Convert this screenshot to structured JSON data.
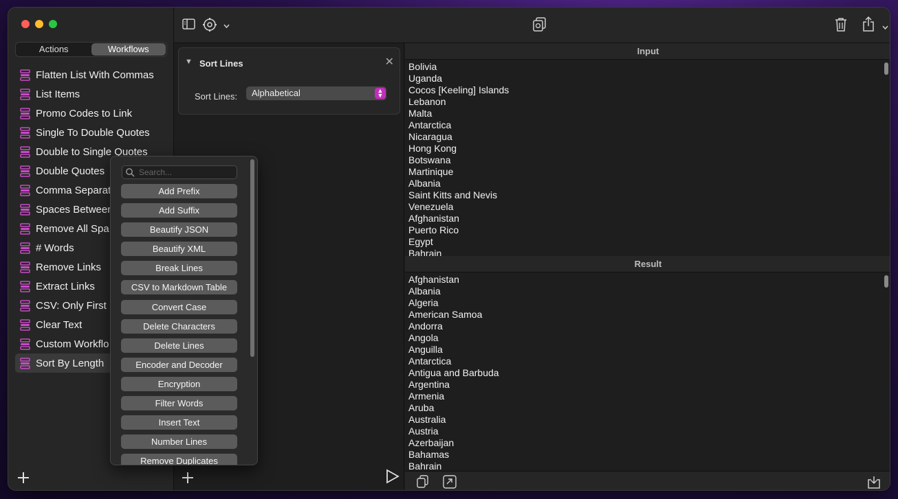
{
  "sidebar": {
    "segments": [
      {
        "label": "Actions",
        "active": false
      },
      {
        "label": "Workflows",
        "active": true
      }
    ],
    "workflows": [
      "Flatten List With Commas",
      "List Items",
      "Promo Codes to Link",
      "Single To Double Quotes",
      "Double to Single Quotes",
      "Double Quotes",
      "Comma Separat",
      "Spaces Between",
      "Remove All Spa",
      "# Words",
      "Remove Links",
      "Extract Links",
      "CSV: Only First",
      "Clear Text",
      "Custom Workflo",
      "Sort By Length"
    ],
    "selected_index": 15,
    "accent_color": "#c54cc4"
  },
  "action_card": {
    "title": "Sort Lines",
    "field_label": "Sort Lines:",
    "select_value": "Alphabetical"
  },
  "popup": {
    "search_placeholder": "Search...",
    "items": [
      "Add Prefix",
      "Add Suffix",
      "Beautify JSON",
      "Beautify XML",
      "Break Lines",
      "CSV to Markdown Table",
      "Convert Case",
      "Delete Characters",
      "Delete Lines",
      "Encoder and Decoder",
      "Encryption",
      "Filter Words",
      "Insert Text",
      "Number Lines",
      "Remove Duplicates"
    ]
  },
  "input": {
    "header": "Input",
    "lines": [
      "Bolivia",
      "Uganda",
      "Cocos [Keeling] Islands",
      "Lebanon",
      "Malta",
      "Antarctica",
      "Nicaragua",
      "Hong Kong",
      "Botswana",
      "Martinique",
      "Albania",
      "Saint Kitts and Nevis",
      "Venezuela",
      "Afghanistan",
      "Puerto Rico",
      "Egypt",
      "Bahrain"
    ]
  },
  "result": {
    "header": "Result",
    "lines": [
      "Afghanistan",
      "Albania",
      "Algeria",
      "American Samoa",
      "Andorra",
      "Angola",
      "Anguilla",
      "Antarctica",
      "Antigua and Barbuda",
      "Argentina",
      "Armenia",
      "Aruba",
      "Australia",
      "Austria",
      "Azerbaijan",
      "Bahamas",
      "Bahrain"
    ]
  }
}
